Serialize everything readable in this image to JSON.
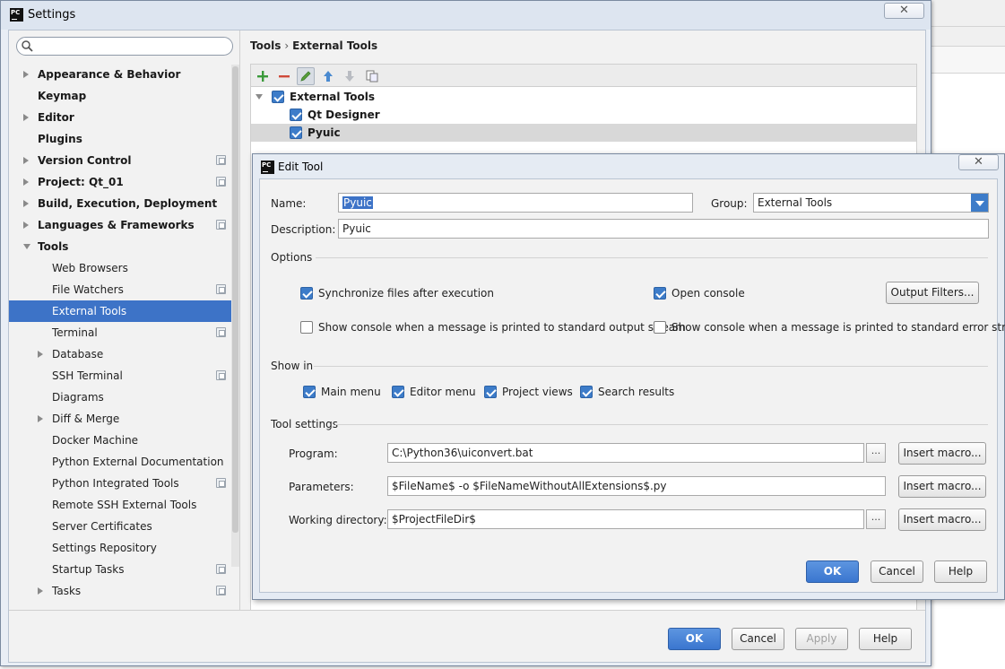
{
  "settings": {
    "title": "Settings",
    "logo": "PC",
    "search": {
      "value": "",
      "placeholder": ""
    },
    "tree": [
      {
        "label": "Appearance & Behavior",
        "bold": true,
        "arrow": "right",
        "icon": false,
        "level": 0,
        "selected": false
      },
      {
        "label": "Keymap",
        "bold": true,
        "arrow": "",
        "icon": false,
        "level": 0,
        "selected": false
      },
      {
        "label": "Editor",
        "bold": true,
        "arrow": "right",
        "icon": false,
        "level": 0,
        "selected": false
      },
      {
        "label": "Plugins",
        "bold": true,
        "arrow": "",
        "icon": false,
        "level": 0,
        "selected": false
      },
      {
        "label": "Version Control",
        "bold": true,
        "arrow": "right",
        "icon": true,
        "level": 0,
        "selected": false
      },
      {
        "label": "Project: Qt_01",
        "bold": true,
        "arrow": "right",
        "icon": true,
        "level": 0,
        "selected": false
      },
      {
        "label": "Build, Execution, Deployment",
        "bold": true,
        "arrow": "right",
        "icon": false,
        "level": 0,
        "selected": false
      },
      {
        "label": "Languages & Frameworks",
        "bold": true,
        "arrow": "right",
        "icon": true,
        "level": 0,
        "selected": false
      },
      {
        "label": "Tools",
        "bold": true,
        "arrow": "down",
        "icon": false,
        "level": 0,
        "selected": false
      },
      {
        "label": "Web Browsers",
        "bold": false,
        "arrow": "",
        "icon": false,
        "level": 1,
        "selected": false
      },
      {
        "label": "File Watchers",
        "bold": false,
        "arrow": "",
        "icon": true,
        "level": 1,
        "selected": false
      },
      {
        "label": "External Tools",
        "bold": false,
        "arrow": "",
        "icon": false,
        "level": 1,
        "selected": true
      },
      {
        "label": "Terminal",
        "bold": false,
        "arrow": "",
        "icon": true,
        "level": 1,
        "selected": false
      },
      {
        "label": "Database",
        "bold": false,
        "arrow": "right",
        "icon": false,
        "level": 1,
        "selected": false
      },
      {
        "label": "SSH Terminal",
        "bold": false,
        "arrow": "",
        "icon": true,
        "level": 1,
        "selected": false
      },
      {
        "label": "Diagrams",
        "bold": false,
        "arrow": "",
        "icon": false,
        "level": 1,
        "selected": false
      },
      {
        "label": "Diff & Merge",
        "bold": false,
        "arrow": "right",
        "icon": false,
        "level": 1,
        "selected": false
      },
      {
        "label": "Docker Machine",
        "bold": false,
        "arrow": "",
        "icon": false,
        "level": 1,
        "selected": false
      },
      {
        "label": "Python External Documentation",
        "bold": false,
        "arrow": "",
        "icon": false,
        "level": 1,
        "selected": false
      },
      {
        "label": "Python Integrated Tools",
        "bold": false,
        "arrow": "",
        "icon": true,
        "level": 1,
        "selected": false
      },
      {
        "label": "Remote SSH External Tools",
        "bold": false,
        "arrow": "",
        "icon": false,
        "level": 1,
        "selected": false
      },
      {
        "label": "Server Certificates",
        "bold": false,
        "arrow": "",
        "icon": false,
        "level": 1,
        "selected": false
      },
      {
        "label": "Settings Repository",
        "bold": false,
        "arrow": "",
        "icon": false,
        "level": 1,
        "selected": false
      },
      {
        "label": "Startup Tasks",
        "bold": false,
        "arrow": "",
        "icon": true,
        "level": 1,
        "selected": false
      },
      {
        "label": "Tasks",
        "bold": false,
        "arrow": "right",
        "icon": true,
        "level": 1,
        "selected": false
      }
    ],
    "breadcrumb": {
      "parent": "Tools",
      "sep": "›",
      "current": "External Tools"
    },
    "toolbar_icons": [
      "add-icon",
      "remove-icon",
      "edit-icon",
      "move-up-icon",
      "move-down-icon",
      "copy-icon"
    ],
    "tool_groups": [
      {
        "label": "External Tools",
        "checked": true,
        "group": true,
        "selected": false
      },
      {
        "label": "Qt Designer",
        "checked": true,
        "group": false,
        "selected": false
      },
      {
        "label": "Pyuic",
        "checked": true,
        "group": false,
        "selected": true
      }
    ],
    "buttons": {
      "ok": "OK",
      "cancel": "Cancel",
      "apply": "Apply",
      "help": "Help"
    }
  },
  "edit_tool": {
    "title": "Edit Tool",
    "name_label": "Name:",
    "name_value": "Pyuic",
    "group_label": "Group:",
    "group_value": "External Tools",
    "description_label": "Description:",
    "description_value": "Pyuic",
    "options_title": "Options",
    "options": {
      "sync_files": {
        "label": "Synchronize files after execution",
        "checked": true
      },
      "open_console": {
        "label": "Open console",
        "checked": true
      },
      "console_stdout": {
        "label": "Show console when a message is printed to standard output stream",
        "checked": false
      },
      "console_stderr": {
        "label": "Show console when a message is printed to standard error stream",
        "checked": false
      }
    },
    "output_filters_label": "Output Filters...",
    "show_in_title": "Show in",
    "show_in": [
      {
        "label": "Main menu",
        "checked": true
      },
      {
        "label": "Editor menu",
        "checked": true
      },
      {
        "label": "Project views",
        "checked": true
      },
      {
        "label": "Search results",
        "checked": true
      }
    ],
    "tool_settings_title": "Tool settings",
    "program_label": "Program:",
    "program_value": "C:\\Python36\\uiconvert.bat",
    "parameters_label": "Parameters:",
    "parameters_value": "$FileName$ -o $FileNameWithoutAllExtensions$.py",
    "working_dir_label": "Working directory:",
    "working_dir_value": "$ProjectFileDir$",
    "browse_label": "...",
    "insert_macro_label": "Insert macro...",
    "buttons": {
      "ok": "OK",
      "cancel": "Cancel",
      "help": "Help"
    }
  },
  "colors": {
    "accent": "#3d73c7",
    "selection": "#3d73c7",
    "checkbox": "#3d7cc9"
  }
}
